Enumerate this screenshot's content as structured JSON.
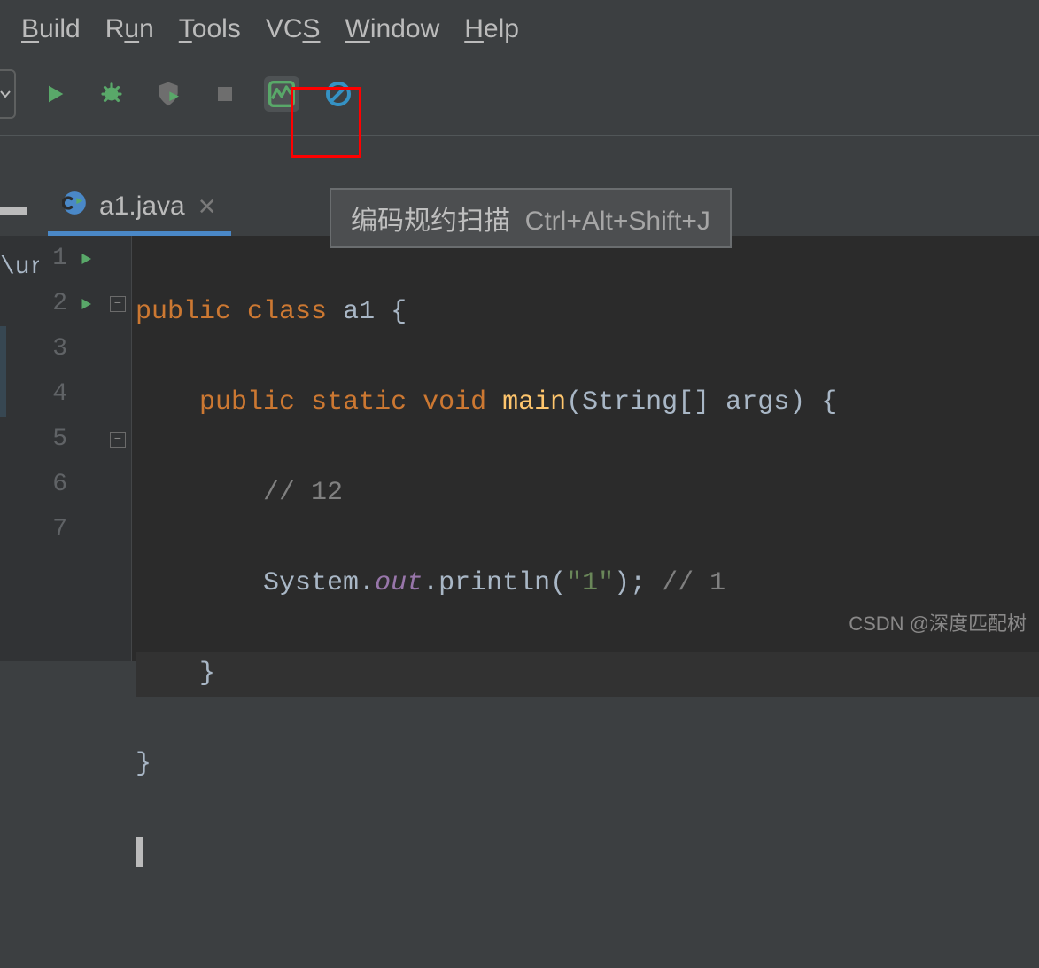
{
  "menubar": {
    "build": "Build",
    "run": "Run",
    "tools": "Tools",
    "vcs": "VCS",
    "window": "Window",
    "help": "Help"
  },
  "toolbar": {
    "run_icon": "run",
    "debug_icon": "bug",
    "coverage_icon": "shield-run",
    "stop_icon": "stop",
    "scan_icon": "activity-monitor",
    "blocked_icon": "no-entry"
  },
  "tooltip": {
    "label": "编码规约扫描",
    "shortcut": "Ctrl+Alt+Shift+J"
  },
  "tab": {
    "filename": "a1.java",
    "icon": "java-class-icon"
  },
  "editor": {
    "path_stub": "\\ur",
    "lines": [
      {
        "n": 1,
        "run": true,
        "fold": null,
        "modified": false
      },
      {
        "n": 2,
        "run": true,
        "fold": "minus",
        "modified": false
      },
      {
        "n": 3,
        "run": false,
        "fold": null,
        "modified": true
      },
      {
        "n": 4,
        "run": false,
        "fold": null,
        "modified": true
      },
      {
        "n": 5,
        "run": false,
        "fold": "minus",
        "modified": false,
        "highlight": true
      },
      {
        "n": 6,
        "run": false,
        "fold": null,
        "modified": false
      },
      {
        "n": 7,
        "run": false,
        "fold": null,
        "modified": false
      }
    ],
    "code": {
      "l1_public": "public",
      "l1_class": "class",
      "l1_name": "a1",
      "l1_brace": " {",
      "l2_public": "public",
      "l2_static": "static",
      "l2_void": "void",
      "l2_main": "main",
      "l2_params": "(String[] args) {",
      "l3_comment": "// 12",
      "l4_sys": "System.",
      "l4_out": "out",
      "l4_println": ".println(",
      "l4_str": "\"1\"",
      "l4_end": ");",
      "l4_comment": " // 1",
      "l5_brace": "}",
      "l6_brace": "}"
    }
  },
  "watermark": "CSDN @深度匹配树"
}
